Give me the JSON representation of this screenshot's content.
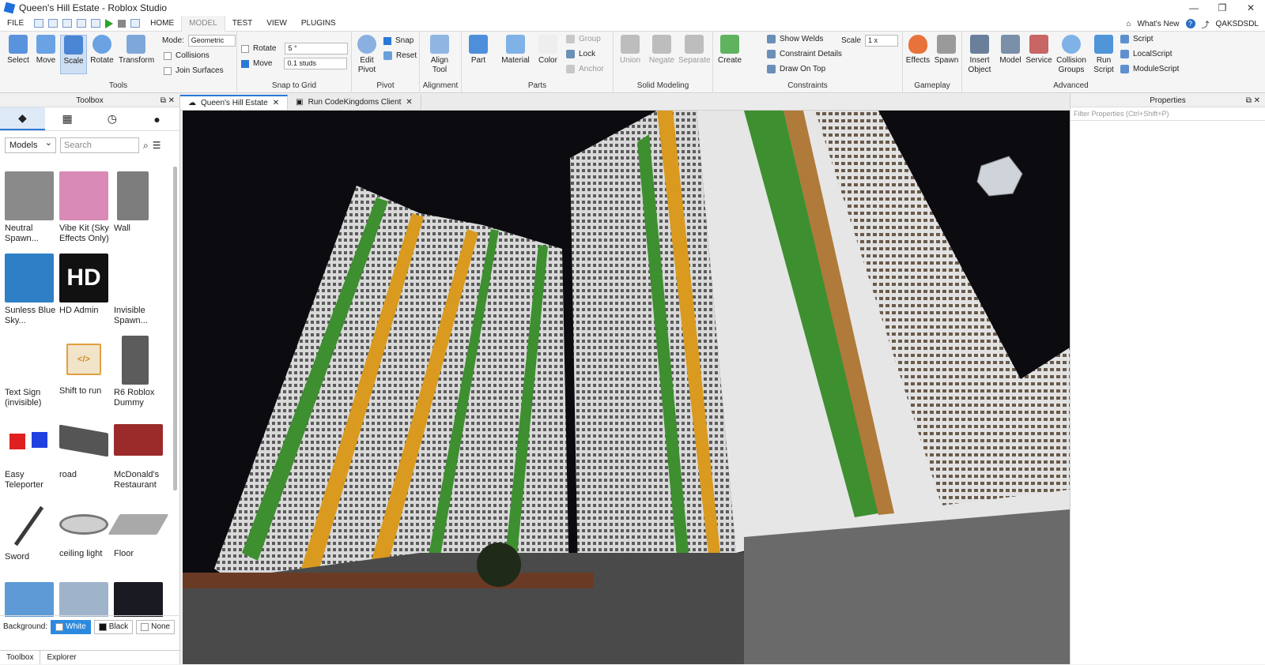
{
  "window": {
    "title": "Queen's Hill Estate - Roblox Studio",
    "controls": [
      "—",
      "❐",
      "✕"
    ]
  },
  "menu": {
    "file": "FILE",
    "tabs": [
      "HOME",
      "MODEL",
      "TEST",
      "VIEW",
      "PLUGINS"
    ],
    "active_tab": "MODEL",
    "whats_new": "What's New",
    "user": "QAKSDSDL"
  },
  "ribbon": {
    "tools": {
      "label": "Tools",
      "buttons": [
        "Select",
        "Move",
        "Scale",
        "Rotate",
        "Transform"
      ],
      "mode_label": "Mode:",
      "mode_value": "Geometric",
      "collisions": "Collisions",
      "join_surfaces": "Join Surfaces"
    },
    "snap": {
      "label": "Snap to Grid",
      "rotate": "Rotate",
      "rotate_value": "5 °",
      "move": "Move",
      "move_value": "0.1 studs"
    },
    "pivot": {
      "label": "Pivot",
      "edit_pivot": "Edit Pivot",
      "snap": "Snap",
      "reset": "Reset"
    },
    "alignment": {
      "label": "Alignment",
      "align_tool": "Align Tool"
    },
    "parts": {
      "label": "Parts",
      "part": "Part",
      "material": "Material",
      "color": "Color",
      "group": "Group",
      "lock": "Lock",
      "anchor": "Anchor"
    },
    "solid": {
      "label": "Solid Modeling",
      "union": "Union",
      "negate": "Negate",
      "separate": "Separate"
    },
    "constraints": {
      "label": "Constraints",
      "create": "Create",
      "show_welds": "Show Welds",
      "details": "Constraint Details",
      "draw_on_top": "Draw On Top",
      "scale_label": "Scale",
      "scale_value": "1 x"
    },
    "gameplay": {
      "label": "Gameplay",
      "effects": "Effects",
      "spawn": "Spawn"
    },
    "advanced": {
      "label": "Advanced",
      "insert": "Insert Object",
      "model": "Model",
      "service": "Service",
      "collision": "Collision Groups",
      "run": "Run Script",
      "script": "Script",
      "local": "LocalScript",
      "module": "ModuleScript"
    }
  },
  "toolbox": {
    "title": "Toolbox",
    "category": "Models",
    "search_placeholder": "Search",
    "items": [
      {
        "label": "Neutral Spawn...",
        "color": "#8a8a8a"
      },
      {
        "label": "Vibe Kit (Sky Effects Only)",
        "color": "#d98ab6"
      },
      {
        "label": "Wall",
        "color": "#7d7d7d"
      },
      {
        "label": "Sunless Blue Sky...",
        "color": "#2f7fc6"
      },
      {
        "label": "HD Admin",
        "color": "#111111"
      },
      {
        "label": "Invisible Spawn...",
        "color": "#ffffff"
      },
      {
        "label": "Text Sign (invisible)",
        "color": "#ffffff"
      },
      {
        "label": "Shift to run",
        "color": "#f2e4c8"
      },
      {
        "label": "R6 Roblox Dummy",
        "color": "#5c5c5c"
      },
      {
        "label": "Easy Teleporter",
        "color": "#ffffff"
      },
      {
        "label": "road",
        "color": "#555555"
      },
      {
        "label": "McDonald's Restaurant",
        "color": "#9b2a2a"
      },
      {
        "label": "Sword",
        "color": "#ffffff"
      },
      {
        "label": "ceiling light",
        "color": "#cfcfcf"
      },
      {
        "label": "Floor",
        "color": "#a9a9a9"
      },
      {
        "label": "",
        "color": "#5d9ad6"
      },
      {
        "label": "",
        "color": "#9fb4cb"
      },
      {
        "label": "",
        "color": "#1a1a22"
      }
    ],
    "hd_text": "HD",
    "background_label": "Background:",
    "bg_white": "White",
    "bg_black": "Black",
    "bg_none": "None",
    "bottom_tabs": [
      "Toolbox",
      "Explorer"
    ]
  },
  "tabs": [
    {
      "label": "Queen's Hill Estate"
    },
    {
      "label": "Run CodeKingdoms Client"
    }
  ],
  "properties": {
    "title": "Properties",
    "filter_placeholder": "Filter Properties (Ctrl+Shift+P)"
  }
}
